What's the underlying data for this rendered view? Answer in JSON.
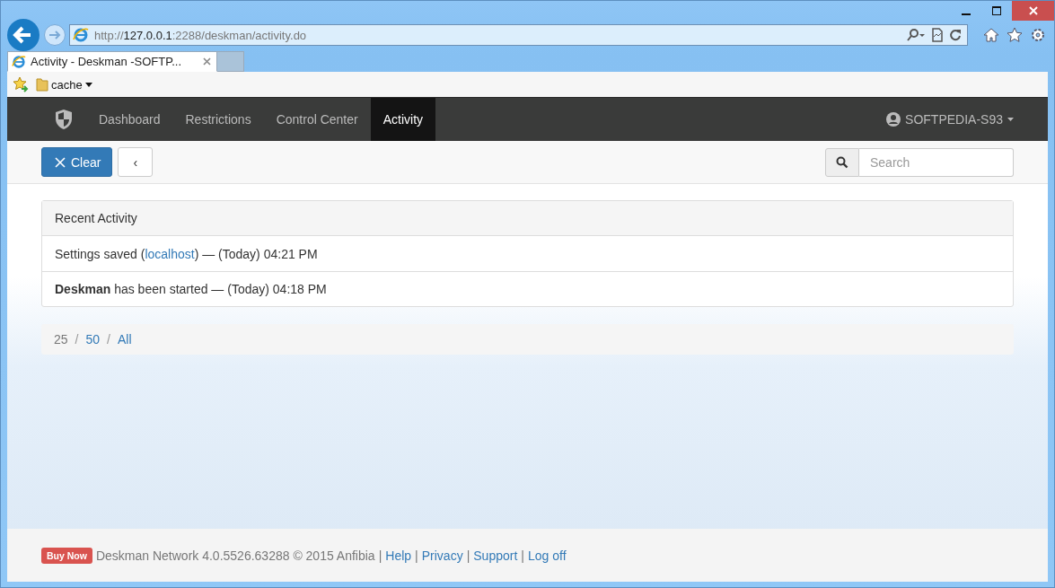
{
  "browser": {
    "address": {
      "scheme": "http://",
      "host": "127.0.0.1",
      "rest": ":2288/deskman/activity.do"
    },
    "tabs": [
      {
        "title": "Activity - Deskman -SOFTP...",
        "selected": true
      }
    ],
    "favorites": [
      {
        "label": "cache"
      }
    ]
  },
  "navbar": {
    "items": [
      {
        "label": "Dashboard",
        "selected": false
      },
      {
        "label": "Restrictions",
        "selected": false
      },
      {
        "label": "Control Center",
        "selected": false
      },
      {
        "label": "Activity",
        "selected": true
      }
    ],
    "user": "SOFTPEDIA-S93"
  },
  "toolbar": {
    "clear_button": "Clear",
    "back_button": "‹",
    "search": {
      "placeholder": "Search"
    }
  },
  "panel": {
    "title": "Recent Activity",
    "rows": [
      {
        "before": "Settings saved (",
        "link": "localhost",
        "after": ") — (Today) 04:21 PM"
      },
      {
        "before": "**Deskman** has been started — (Today) 04:18 PM"
      }
    ]
  },
  "page_sizes": {
    "separator": "/",
    "options": [
      {
        "label": "25",
        "selected": true
      },
      {
        "label": "50",
        "selected": false
      },
      {
        "label": "All",
        "selected": false
      }
    ]
  },
  "footer": {
    "badge": "Buy Now",
    "text": "Deskman Network 4.0.5526.63288 © 2015 Anfibia",
    "separator": "|",
    "links": [
      "Help",
      "Privacy",
      "Support",
      "Log off"
    ]
  }
}
